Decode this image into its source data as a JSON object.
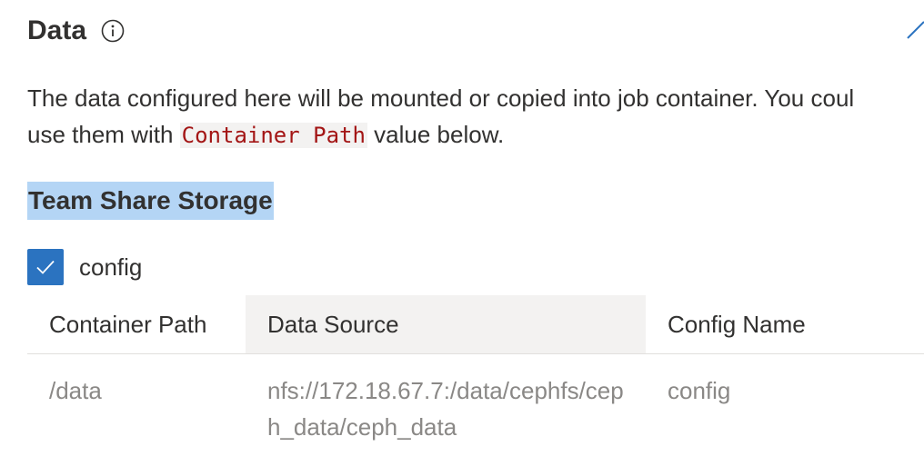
{
  "section": {
    "title": "Data",
    "info_icon": "info-icon",
    "edit_icon": "pencil-icon"
  },
  "description": {
    "line1": "The data configured here will be mounted or copied into job container. You coul",
    "line2_before": "use them with ",
    "code": "Container Path",
    "line2_after": " value below."
  },
  "team_share": {
    "title": "Team Share Storage",
    "checkbox_label": "config",
    "checked": true
  },
  "table": {
    "columns": [
      "Container Path",
      "Data Source",
      "Config Name"
    ],
    "rows": [
      [
        "/data",
        "nfs://172.18.67.7:/data/cephfs/ceph_data/ceph_data",
        "config"
      ]
    ]
  },
  "colors": {
    "accent": "#2b73c0",
    "highlight": "#b4d5f5",
    "code_text": "#a31515",
    "muted_text": "#8a8886"
  }
}
